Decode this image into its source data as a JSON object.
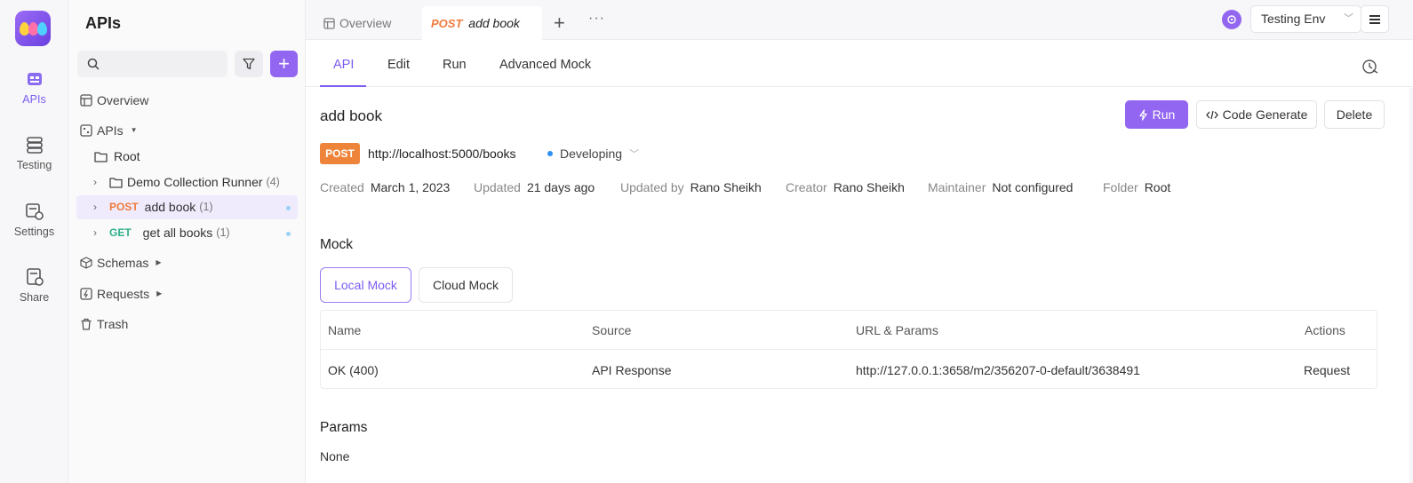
{
  "rail": {
    "items": [
      {
        "label": "APIs",
        "icon": "apis-icon",
        "active": true
      },
      {
        "label": "Testing",
        "icon": "testing-icon"
      },
      {
        "label": "Settings",
        "icon": "settings-icon"
      },
      {
        "label": "Share",
        "icon": "share-icon"
      }
    ]
  },
  "sidebar": {
    "title": "APIs",
    "search_placeholder": "",
    "nav": {
      "overview": "Overview",
      "apis": "APIs",
      "schemas": "Schemas",
      "requests": "Requests",
      "trash": "Trash"
    },
    "tree": {
      "root": "Root",
      "folder": {
        "label": "Demo Collection Runner",
        "count": "(4)"
      },
      "items": [
        {
          "method": "POST",
          "label": "add book",
          "count": "(1)",
          "selected": true
        },
        {
          "method": "GET",
          "label": "get all books",
          "count": "(1)"
        }
      ]
    }
  },
  "tabs": {
    "overview": "Overview",
    "active": {
      "method": "POST",
      "label": "add book"
    },
    "plus": "+",
    "more": "···"
  },
  "env": {
    "label": "Testing Env"
  },
  "subtabs": [
    "API",
    "Edit",
    "Run",
    "Advanced Mock"
  ],
  "api": {
    "name": "add book",
    "method": "POST",
    "url": "http://localhost:5000/books",
    "status": "Developing",
    "buttons": {
      "run": "Run",
      "code": "Code Generate",
      "delete": "Delete"
    },
    "meta": [
      {
        "k": "Created",
        "v": "March 1, 2023"
      },
      {
        "k": "Updated",
        "v": "21 days ago"
      },
      {
        "k": "Updated by",
        "v": "Rano Sheikh"
      },
      {
        "k": "Creator",
        "v": "Rano Sheikh"
      },
      {
        "k": "Maintainer",
        "v": "Not configured"
      },
      {
        "k": "Folder",
        "v": "Root"
      }
    ]
  },
  "mock": {
    "title": "Mock",
    "tabs": {
      "local": "Local Mock",
      "cloud": "Cloud Mock"
    },
    "columns": [
      "Name",
      "Source",
      "URL & Params",
      "Actions"
    ],
    "rows": [
      {
        "name": "OK (400)",
        "source": "API Response",
        "url": "http://127.0.0.1:3658/m2/356207-0-default/3638491",
        "action": "Request"
      }
    ]
  },
  "params": {
    "title": "Params",
    "value": "None"
  },
  "colors": {
    "accent": "#9266f0",
    "post": "#ee8439",
    "get": "#2fb08a"
  }
}
